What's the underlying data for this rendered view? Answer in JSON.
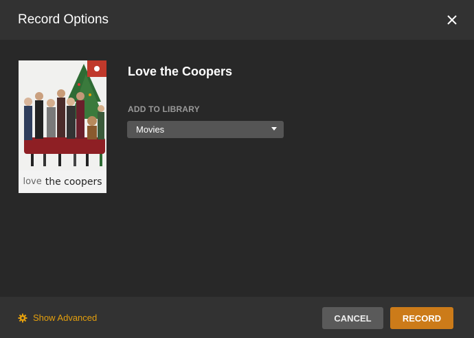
{
  "dialog": {
    "title": "Record Options",
    "close_icon": "close-icon"
  },
  "program": {
    "title": "Love the Coopers",
    "poster_caption_part1": "love",
    "poster_caption_part2": "the coopers",
    "record_badge_icon": "record-dot-icon"
  },
  "library": {
    "label": "ADD TO LIBRARY",
    "selected": "Movies"
  },
  "footer": {
    "advanced_label": "Show Advanced",
    "advanced_icon": "gear-icon",
    "cancel_label": "CANCEL",
    "record_label": "RECORD"
  },
  "colors": {
    "accent": "#e5a00d",
    "record_button": "#cc7b19",
    "record_badge": "#c0392b",
    "background": "#282828",
    "header_footer": "#323232"
  }
}
